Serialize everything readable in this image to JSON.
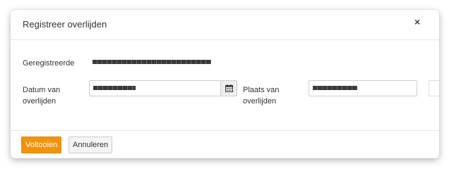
{
  "dialog": {
    "title": "Registreer overlijden",
    "close_label": "×"
  },
  "form": {
    "registered_label": "Geregistreerde",
    "date_label_line1": "Datum van",
    "date_label_line2": "overlijden",
    "place_label_line1": "Plaats van",
    "place_label_line2": "overlijden",
    "calendar_icon": "calendar-icon"
  },
  "footer": {
    "complete_label": "Voltooien",
    "cancel_label": "Annuleren"
  },
  "colors": {
    "primary": "#f0930b",
    "redaction": "#404040"
  }
}
